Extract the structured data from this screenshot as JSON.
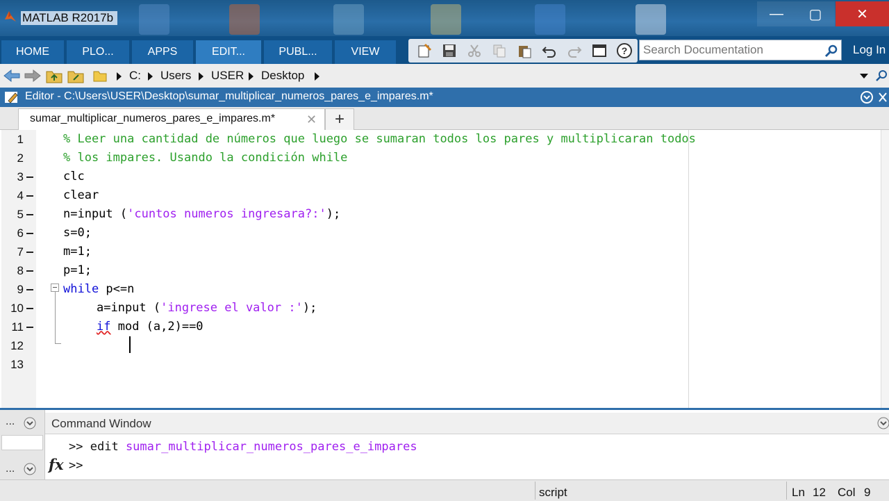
{
  "window": {
    "title": "MATLAB R2017b",
    "minimize": "—",
    "maximize": "▢",
    "close": "✕"
  },
  "ribbon": {
    "tabs": [
      {
        "label": "HOME"
      },
      {
        "label": "PLO..."
      },
      {
        "label": "APPS"
      },
      {
        "label": "EDIT..."
      },
      {
        "label": "PUBL..."
      },
      {
        "label": "VIEW"
      }
    ],
    "search_placeholder": "Search Documentation",
    "login_label": "Log In"
  },
  "address": {
    "crumbs": [
      "C:",
      "Users",
      "USER",
      "Desktop"
    ]
  },
  "editor": {
    "title": "Editor - C:\\Users\\USER\\Desktop\\sumar_multiplicar_numeros_pares_e_impares.m*",
    "tab_label": "sumar_multiplicar_numeros_pares_e_impares.m*",
    "new_tab": "+",
    "line_numbers": [
      "1",
      "2",
      "3",
      "4",
      "5",
      "6",
      "7",
      "8",
      "9",
      "10",
      "11",
      "12",
      "13"
    ],
    "lines": {
      "l1": "% Leer una cantidad de números que luego se sumaran todos los pares y multiplicaran todos",
      "l2": "% los impares. Usando la condición while",
      "l3": "clc",
      "l4": "clear",
      "l5_a": "n=input (",
      "l5_s": "'cuntos numeros ingresara?:'",
      "l5_b": ");",
      "l6": "s=0;",
      "l7": "m=1;",
      "l8": "p=1;",
      "l9_kw": "while",
      "l9_rest": " p<=n",
      "l10_a": "a=input (",
      "l10_s": "'ingrese el valor :'",
      "l10_b": ");",
      "l11_kw": "if",
      "l11_rest": " mod (a,2)==0"
    }
  },
  "command_window": {
    "title": "Command Window",
    "prompt": ">>",
    "history_cmd": "edit",
    "history_arg": "sumar_multiplicar_numeros_pares_e_impares",
    "left_ellipsis_top": "...",
    "left_ellipsis_bottom": "..."
  },
  "status": {
    "mode": "script",
    "ln_label": "Ln",
    "ln_value": "12",
    "col_label": "Col",
    "col_value": "9"
  },
  "colors": {
    "comment": "#2ca02c",
    "keyword": "#1010d8",
    "string": "#a020f0",
    "ribbon": "#0f4f86",
    "close": "#c9302c"
  }
}
